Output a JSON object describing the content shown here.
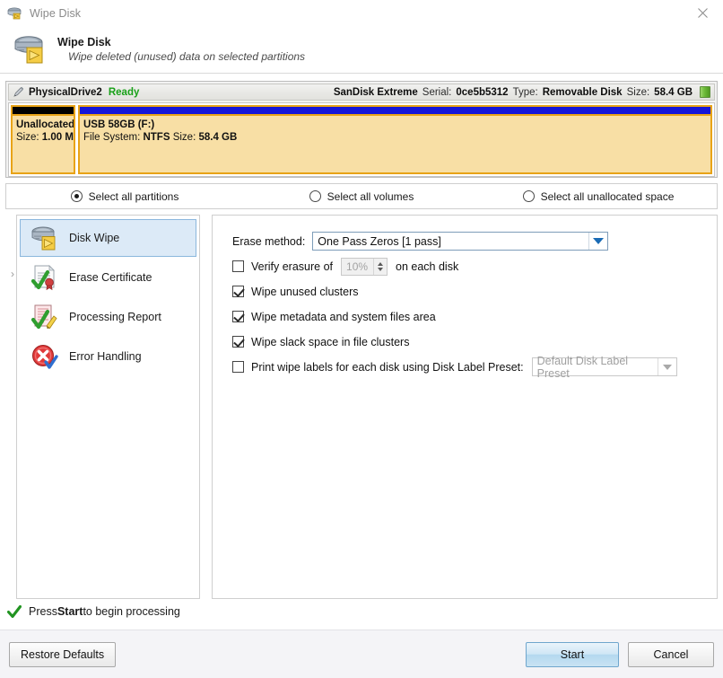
{
  "window": {
    "title": "Wipe Disk",
    "close_icon": "close-icon",
    "title_icon": "wipe-disk-icon"
  },
  "header": {
    "icon": "wipe-disk-icon",
    "title": "Wipe Disk",
    "subtitle": "Wipe deleted (unused) data on selected partitions"
  },
  "disk": {
    "icon": "pen-icon",
    "name": "PhysicalDrive2",
    "state": "Ready",
    "model": "SanDisk Extreme",
    "serial_label": "Serial:",
    "serial_value": "0ce5b5312",
    "type_label": "Type:",
    "type_value": "Removable Disk",
    "size_label": "Size:",
    "size_value": "58.4 GB",
    "chip_icon": "disk-chip-icon",
    "partitions": [
      {
        "title": "Unallocated",
        "line_prefix": "Size: ",
        "line_value": "1.00 M",
        "usage_color": "#000000",
        "kind": "unallocated"
      },
      {
        "title": "USB 58GB (F:)",
        "fs_label": "File System:",
        "fs_value": "NTFS",
        "size_label": "Size:",
        "size_value": "58.4 GB",
        "usage_color": "#1616d8",
        "kind": "volume"
      }
    ]
  },
  "selection": {
    "options": [
      {
        "label": "Select all partitions",
        "checked": true
      },
      {
        "label": "Select all volumes",
        "checked": false
      },
      {
        "label": "Select all unallocated space",
        "checked": false
      }
    ]
  },
  "sidebar": {
    "chevron": "›",
    "items": [
      {
        "label": "Disk Wipe",
        "icon": "disk-wipe-icon",
        "selected": true
      },
      {
        "label": "Erase Certificate",
        "icon": "certificate-icon",
        "selected": false
      },
      {
        "label": "Processing Report",
        "icon": "report-icon",
        "selected": false
      },
      {
        "label": "Error Handling",
        "icon": "error-icon",
        "selected": false
      }
    ]
  },
  "options": {
    "erase_method_label": "Erase method:",
    "erase_method_value": "One Pass Zeros [1 pass]",
    "verify": {
      "label": "Verify erasure of",
      "checked": false,
      "percent": "10%",
      "suffix": "on each disk"
    },
    "checkboxes": [
      {
        "label": "Wipe unused clusters",
        "checked": true
      },
      {
        "label": "Wipe metadata and system files area",
        "checked": true
      },
      {
        "label": "Wipe slack space in file clusters",
        "checked": true
      }
    ],
    "print_labels": {
      "label": "Print wipe labels for each disk using Disk Label Preset:",
      "checked": false,
      "preset_value": "Default Disk Label Preset"
    }
  },
  "status": {
    "icon": "green-check-icon",
    "prefix": "Press ",
    "bold": "Start",
    "suffix": " to begin processing"
  },
  "footer": {
    "restore_defaults": "Restore Defaults",
    "start": "Start",
    "cancel": "Cancel"
  },
  "colors": {
    "accent_blue": "#1a6bb5",
    "ready_green": "#18a018",
    "partition_border": "#e8a317",
    "partition_fill": "#f8dfa5"
  }
}
